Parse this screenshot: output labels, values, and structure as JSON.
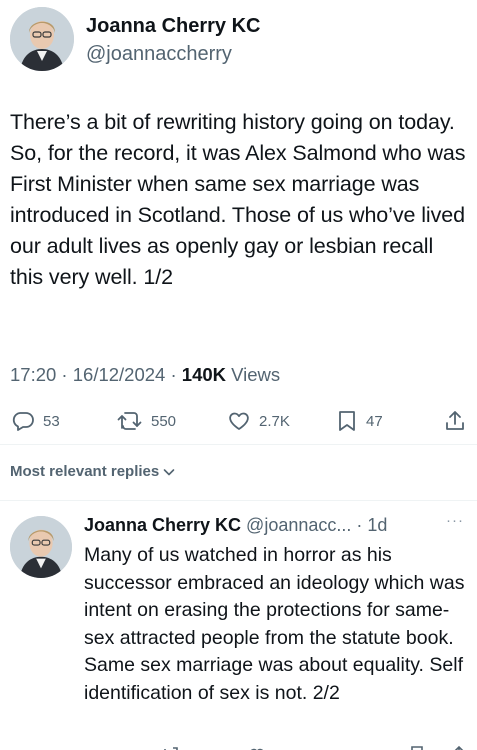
{
  "tweet": {
    "author_name": "Joanna Cherry KC",
    "author_handle": "@joannaccherry",
    "text": "There’s a bit of rewriting history going on today. So, for the record, it was Alex Salmond who was First Minister when same sex marriage was introduced in Scotland. Those of us who’ve lived our adult lives as openly gay or lesbian recall this very well. 1/2",
    "time": "17:20 · 16/12/2024 · ",
    "views_count": "140K",
    "views_label": " Views",
    "actions": {
      "replies": "53",
      "retweets": "550",
      "likes": "2.7K",
      "bookmarks": "47"
    }
  },
  "replies_section": {
    "sort_label": "Most relevant replies"
  },
  "reply": {
    "author_name": "Joanna Cherry KC",
    "author_handle": "@joannacc... · 1d",
    "more": "···",
    "text": "Many of us watched in horror as his successor embraced an ideology which was intent on erasing the protections for same-sex attracted people from the statute book. Same sex marriage was about equality. Self identification of sex is not. 2/2"
  },
  "icons": {
    "reply": "speech-bubble-icon",
    "retweet": "retweet-icon",
    "like": "heart-icon",
    "bookmark": "bookmark-icon",
    "share": "share-icon",
    "chevron": "chevron-down-icon"
  },
  "colors": {
    "text": "#0f1419",
    "secondary": "#536471",
    "divider": "#eff3f4"
  }
}
